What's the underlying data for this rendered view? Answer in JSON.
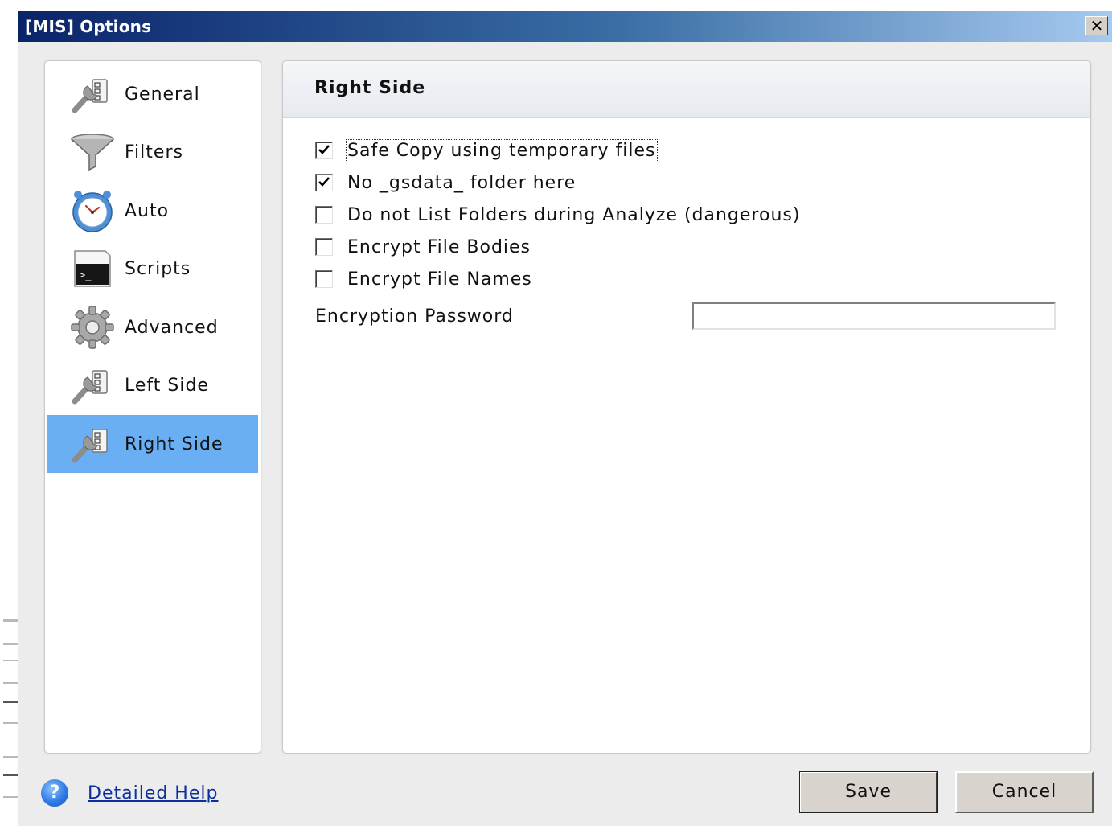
{
  "window": {
    "title": "[MIS] Options",
    "close_glyph": "✕"
  },
  "nav": {
    "items": [
      {
        "label": "General",
        "icon": "wrench-checklist-icon"
      },
      {
        "label": "Filters",
        "icon": "funnel-icon"
      },
      {
        "label": "Auto",
        "icon": "clock-icon"
      },
      {
        "label": "Scripts",
        "icon": "terminal-icon"
      },
      {
        "label": "Advanced",
        "icon": "gear-icon"
      },
      {
        "label": "Left Side",
        "icon": "wrench-checklist-icon"
      },
      {
        "label": "Right Side",
        "icon": "wrench-checklist-icon"
      }
    ],
    "selected": "Right Side"
  },
  "content": {
    "title": "Right Side",
    "options": [
      {
        "label": "Safe Copy using temporary files",
        "checked": true
      },
      {
        "label": "No _gsdata_ folder here",
        "checked": true
      },
      {
        "label": "Do not List Folders during Analyze (dangerous)",
        "checked": false
      },
      {
        "label": "Encrypt File Bodies",
        "checked": false
      },
      {
        "label": "Encrypt File Names",
        "checked": false
      }
    ],
    "password_label": "Encryption Password",
    "password_value": ""
  },
  "footer": {
    "help_icon_glyph": "?",
    "help_link": "Detailed Help",
    "save_label": "Save",
    "cancel_label": "Cancel"
  },
  "colors": {
    "selection": "#6aaef3",
    "titlebar_start": "#0a246a",
    "titlebar_end": "#a6caf0",
    "link": "#0b2f9c"
  }
}
